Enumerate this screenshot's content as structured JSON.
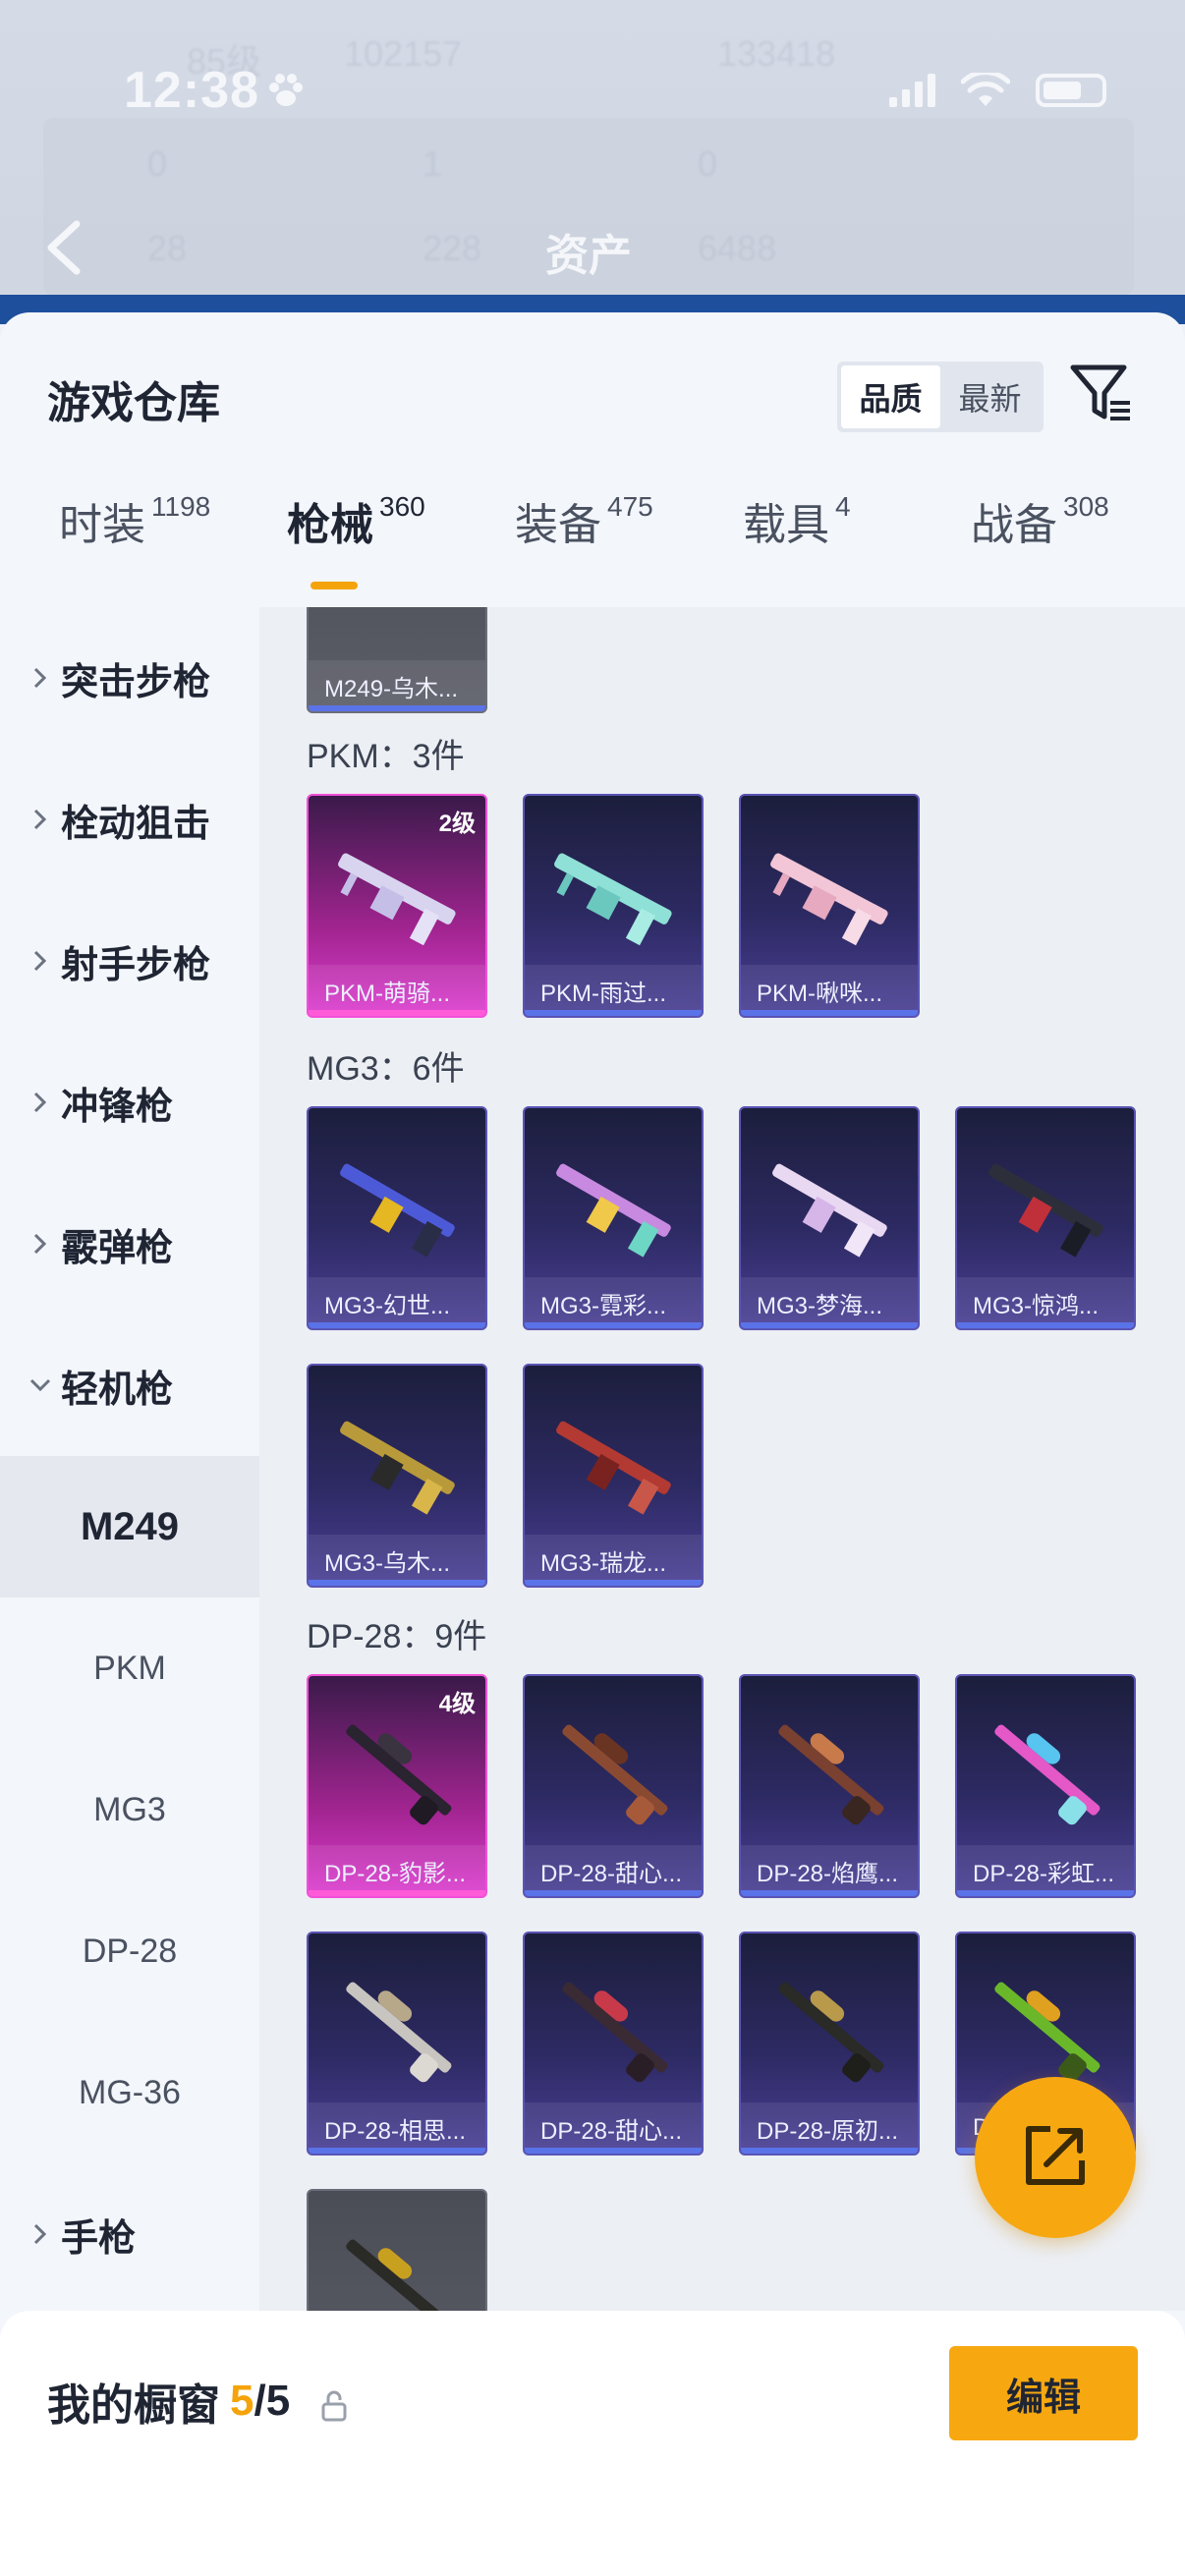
{
  "status_bar": {
    "time": "12:38",
    "paw_icon": "paw-icon",
    "signal_icon": "signal-icon",
    "wifi_icon": "wifi-icon",
    "battery_icon": "battery-icon"
  },
  "background_header": {
    "title": "资产",
    "ghost_texts": [
      "85级",
      "102157",
      "133418",
      "0",
      "1",
      "0",
      "28",
      "228",
      "6488"
    ]
  },
  "sheet": {
    "title": "游戏仓库",
    "sort": {
      "options": [
        "品质",
        "最新"
      ],
      "selected": "品质"
    },
    "filter_icon": "filter-icon",
    "tabs": [
      {
        "label": "时装",
        "count": "1198"
      },
      {
        "label": "枪械",
        "count": "360",
        "active": true
      },
      {
        "label": "装备",
        "count": "475"
      },
      {
        "label": "载具",
        "count": "4"
      },
      {
        "label": "战备",
        "count": "308"
      }
    ]
  },
  "sidebar": {
    "categories": [
      {
        "label": "突击步枪",
        "expanded": false
      },
      {
        "label": "栓动狙击",
        "expanded": false
      },
      {
        "label": "射手步枪",
        "expanded": false
      },
      {
        "label": "冲锋枪",
        "expanded": false
      },
      {
        "label": "霰弹枪",
        "expanded": false
      },
      {
        "label": "轻机枪",
        "expanded": true
      }
    ],
    "subcategories": [
      {
        "label": "M249",
        "active": true
      },
      {
        "label": "PKM"
      },
      {
        "label": "MG3"
      },
      {
        "label": "DP-28"
      },
      {
        "label": "MG-36"
      }
    ],
    "last_category": {
      "label": "手枪",
      "expanded": false
    }
  },
  "main": {
    "top_partial_item": {
      "name": "M249-乌木..."
    },
    "groups": [
      {
        "label": "PKM：3件",
        "items": [
          {
            "name": "PKM-萌骑...",
            "rarity": "pink",
            "level": "2级"
          },
          {
            "name": "PKM-雨过...",
            "rarity": "purple"
          },
          {
            "name": "PKM-啾咪...",
            "rarity": "purple"
          }
        ]
      },
      {
        "label": "MG3：6件",
        "items": [
          {
            "name": "MG3-幻世...",
            "rarity": "purple"
          },
          {
            "name": "MG3-霓彩...",
            "rarity": "purple"
          },
          {
            "name": "MG3-梦海...",
            "rarity": "purple"
          },
          {
            "name": "MG3-惊鸿...",
            "rarity": "purple"
          },
          {
            "name": "MG3-乌木...",
            "rarity": "purple"
          },
          {
            "name": "MG3-瑞龙...",
            "rarity": "purple"
          }
        ]
      },
      {
        "label": "DP-28：9件",
        "items": [
          {
            "name": "DP-28-豹影...",
            "rarity": "pink",
            "level": "4级"
          },
          {
            "name": "DP-28-甜心...",
            "rarity": "purple"
          },
          {
            "name": "DP-28-焰鹰...",
            "rarity": "purple"
          },
          {
            "name": "DP-28-彩虹...",
            "rarity": "purple"
          },
          {
            "name": "DP-28-相思...",
            "rarity": "purple"
          },
          {
            "name": "DP-28-甜心...",
            "rarity": "purple"
          },
          {
            "name": "DP-28-原初...",
            "rarity": "purple"
          },
          {
            "name": "D",
            "rarity": "purple"
          },
          {
            "name": "",
            "rarity": "grey"
          }
        ]
      }
    ]
  },
  "fab": {
    "icon": "share-icon"
  },
  "bottom_bar": {
    "title": "我的橱窗",
    "current": "5",
    "separator_total": "/5",
    "lock_icon": "lock-icon",
    "edit_label": "编辑"
  },
  "colors": {
    "accent": "#f7a810",
    "pink_rarity": "#dd3ed0",
    "purple_rarity": "#4a3f95",
    "grey_rarity": "#5b5d67"
  }
}
